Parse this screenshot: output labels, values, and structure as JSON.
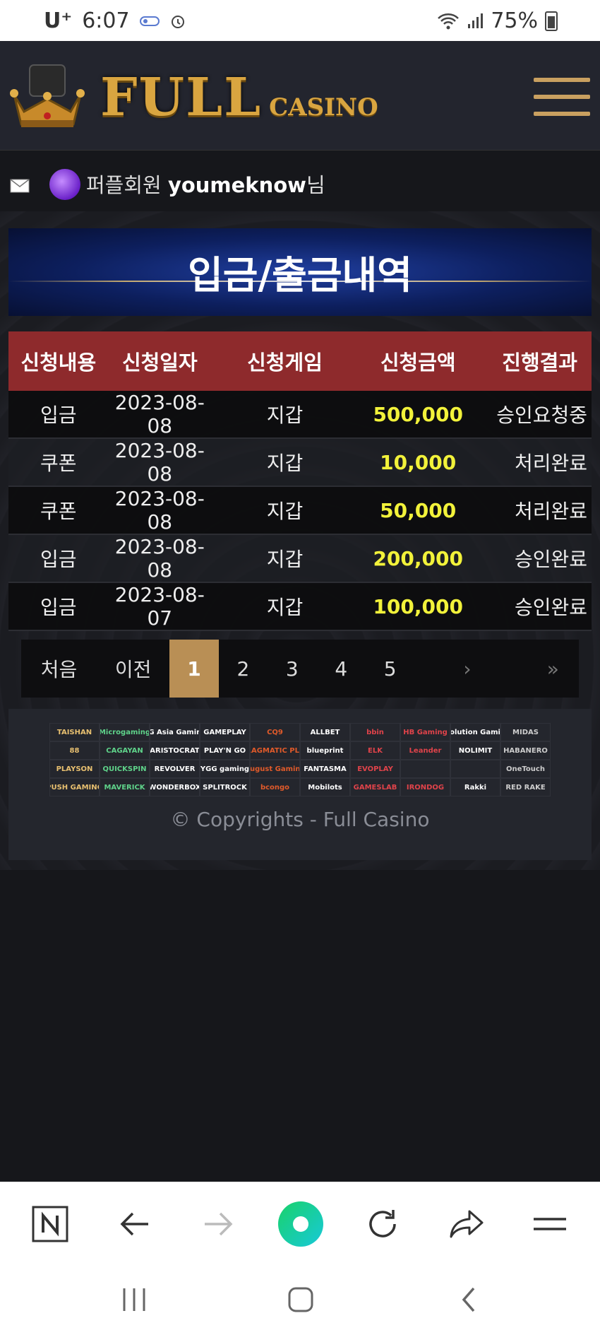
{
  "status_bar": {
    "carrier": "U⁺",
    "time": "6:07",
    "battery": "75%",
    "icons": [
      "vpn-key-icon",
      "alarm-icon",
      "wifi-icon",
      "signal-icon",
      "battery-icon"
    ]
  },
  "header": {
    "logo_full": "FULL",
    "logo_casino": "CASINO",
    "menu_icon": "hamburger-menu-icon",
    "brand_color": "#d9a540"
  },
  "user": {
    "mail_icon": "mail-icon",
    "level": "퍼플회원",
    "username": "youmeknow",
    "suffix": "님"
  },
  "page": {
    "title": "입금/출금내역"
  },
  "table": {
    "headers": [
      "신청내용",
      "신청일자",
      "신청게임",
      "신청금액",
      "진행결과"
    ],
    "rows": [
      {
        "type": "입금",
        "date": "2023-08-08",
        "game": "지갑",
        "amount": "500,000",
        "result": "승인요청중"
      },
      {
        "type": "쿠폰",
        "date": "2023-08-08",
        "game": "지갑",
        "amount": "10,000",
        "result": "처리완료"
      },
      {
        "type": "쿠폰",
        "date": "2023-08-08",
        "game": "지갑",
        "amount": "50,000",
        "result": "처리완료"
      },
      {
        "type": "입금",
        "date": "2023-08-08",
        "game": "지갑",
        "amount": "200,000",
        "result": "승인완료"
      },
      {
        "type": "입금",
        "date": "2023-08-07",
        "game": "지갑",
        "amount": "100,000",
        "result": "승인완료"
      }
    ],
    "header_color": "#8e2a2c",
    "amount_color": "#f2f23a"
  },
  "pagination": {
    "first": "처음",
    "prev": "이전",
    "pages": [
      "1",
      "2",
      "3",
      "4",
      "5"
    ],
    "current": "1",
    "next": "›",
    "last": "»"
  },
  "footer": {
    "providers": [
      "TAISHAN",
      "Microgaming",
      "AG Asia Gaming",
      "GAMEPLAY",
      "CQ9",
      "ALLBET",
      "bbin",
      "HB Gaming",
      "Evolution Gaming",
      "MIDAS",
      "88",
      "CAGAYAN",
      "ARISTOCRAT",
      "PLAY'N GO",
      "PRAGMATIC PLAY",
      "blueprint",
      "ELK",
      "Leander",
      "NOLIMIT",
      "HABANERO",
      "PLAYSON",
      "QUICKSPIN",
      "REVOLVER",
      "YGG gaming",
      "August Gaming",
      "FANTASMA",
      "EVOPLAY",
      "",
      "",
      "OneTouch",
      "PUSH GAMING",
      "MAVERICK",
      "WONDERBOX",
      "SPLITROCK",
      "bcongo",
      "Mobilots",
      "GAMESLAB",
      "IRONDOG",
      "Rakki",
      "RED RAKE"
    ],
    "copyright": "© Copyrights - Full Casino"
  },
  "browser_toolbar": {
    "icons": [
      "naver-n-icon",
      "back-arrow-icon",
      "forward-arrow-icon",
      "home-circle-icon",
      "refresh-icon",
      "share-icon",
      "menu-icon"
    ]
  },
  "system_nav": {
    "icons": [
      "recent-apps-icon",
      "home-icon",
      "back-icon"
    ]
  }
}
